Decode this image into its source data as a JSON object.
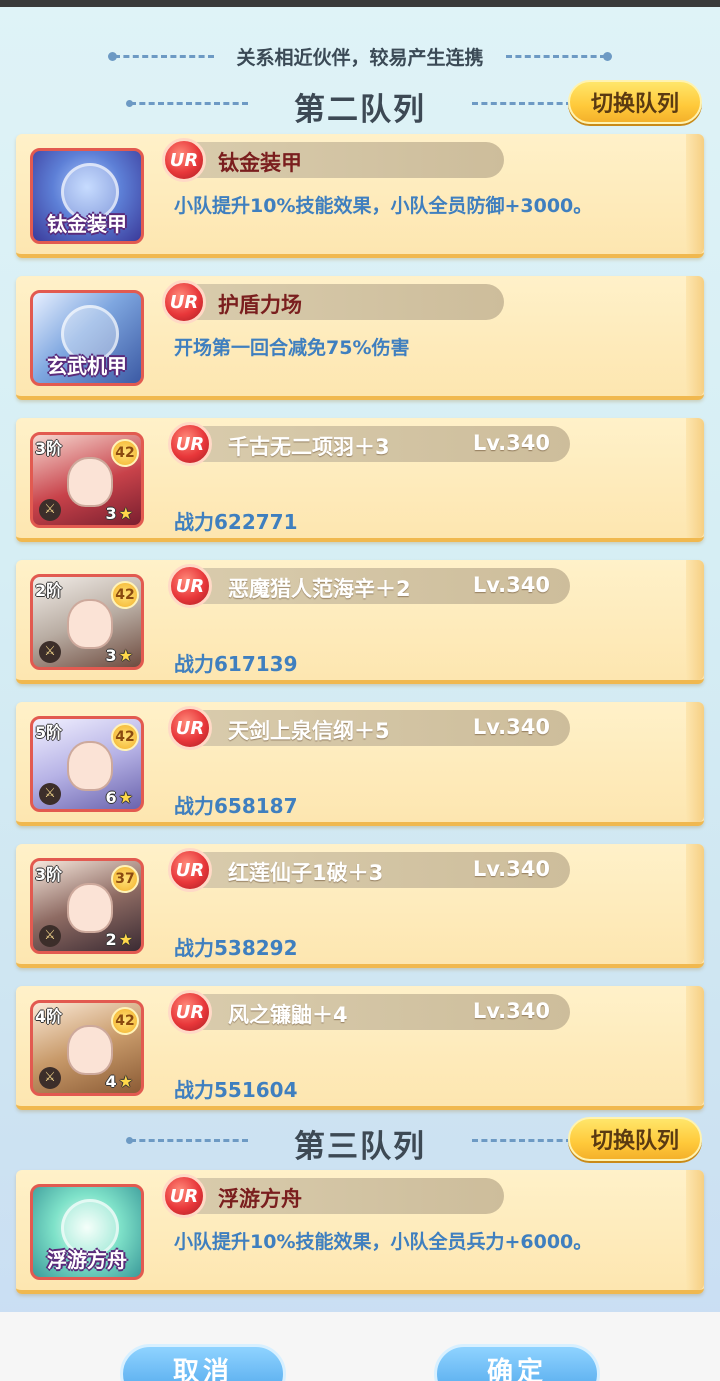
{
  "hint": "关系相近伙伴，较易产生连携",
  "sections": [
    {
      "title": "第二队列",
      "switch_label": "切换队列"
    },
    {
      "title": "第三队列",
      "switch_label": "切换队列"
    }
  ],
  "cards": [
    {
      "kind": "relic",
      "avatar_label": "钛金装甲",
      "grade": "UR",
      "name": "钛金装甲",
      "desc": "小队提升10%技能效果，小队全员防御+3000。"
    },
    {
      "kind": "relic",
      "avatar_label": "玄武机甲",
      "grade": "UR",
      "name": "护盾力场",
      "desc": "开场第一回合减免75%伤害"
    },
    {
      "kind": "hero",
      "rank": "3阶",
      "level": "42",
      "stars": "3",
      "grade": "UR",
      "name": "千古无二项羽＋3",
      "lv": "Lv.340",
      "power": "战力622771"
    },
    {
      "kind": "hero",
      "rank": "2阶",
      "level": "42",
      "stars": "3",
      "grade": "UR",
      "name": "恶魔猎人范海辛＋2",
      "lv": "Lv.340",
      "power": "战力617139"
    },
    {
      "kind": "hero",
      "rank": "5阶",
      "level": "42",
      "stars": "6",
      "grade": "UR",
      "name": "天剑上泉信纲＋5",
      "lv": "Lv.340",
      "power": "战力658187"
    },
    {
      "kind": "hero",
      "rank": "3阶",
      "level": "37",
      "stars": "2",
      "grade": "UR",
      "name": "红莲仙子1破＋3",
      "lv": "Lv.340",
      "power": "战力538292"
    },
    {
      "kind": "hero",
      "rank": "4阶",
      "level": "42",
      "stars": "4",
      "grade": "UR",
      "name": "风之镰鼬＋4",
      "lv": "Lv.340",
      "power": "战力551604"
    },
    {
      "kind": "relic",
      "avatar_label": "浮游方舟",
      "grade": "UR",
      "name": "浮游方舟",
      "desc": "小队提升10%技能效果，小队全员兵力+6000。"
    }
  ],
  "buttons": {
    "cancel": "取消",
    "confirm": "确定"
  }
}
